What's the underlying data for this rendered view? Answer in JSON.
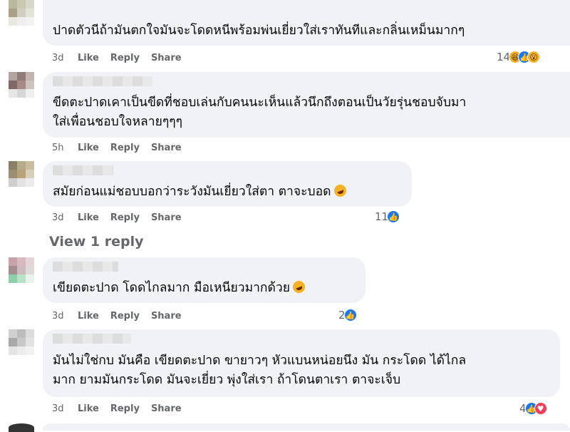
{
  "comments": [
    {
      "text": "ปาดตัวนีถ้ามันตกใจมันจะโดดหนีพร้อมพ่นเยี่ยวใส่เราทันทีและกลิ่นเหม็นมากๆ",
      "time": "3d",
      "like": "Like",
      "reply": "Reply",
      "share": "Share",
      "reaction_count": "14",
      "reactions": [
        "haha",
        "like",
        "wow"
      ]
    },
    {
      "text": "ขีดตะปาดเคาเป็นขีดที่ชอบเล่นกับคนนะเห็นแล้วนึกถึงตอนเป็นวัยรุ่นชอบจับมา\nใส่เพื่อนชอบใจหลายๆๆๆ",
      "time": "5h",
      "like": "Like",
      "reply": "Reply",
      "share": "Share",
      "reaction_count": "",
      "reactions": []
    },
    {
      "text": "สมัยก่อนแม่ชอบบอกว่าระวังมันเยี่ยวใส่ตา ตาจะบอด",
      "time": "3d",
      "like": "Like",
      "reply": "Reply",
      "share": "Share",
      "reaction_count": "11",
      "reactions": [
        "like"
      ]
    },
    {
      "text": "เขียดตะปาด โดดไกลมาก มือเหนียวมากด้วย",
      "time": "3d",
      "like": "Like",
      "reply": "Reply",
      "share": "Share",
      "reaction_count": "2",
      "reactions": [
        "like"
      ]
    },
    {
      "text": "มันไม่ใช่กบ มันคือ เขียดตะปาด ขายาวๆ หัวแบนหน่อยนึง มัน กระโดด ได้ไกล\nมาก ยามมันกระโดด มันจะเยี่ยว พุ่งใส่เรา ถ้าโดนตาเรา ตาจะเจ็บ",
      "time": "3d",
      "like": "Like",
      "reply": "Reply",
      "share": "Share",
      "reaction_count": "4",
      "reactions": [
        "like",
        "love"
      ]
    }
  ],
  "view_replies": "View 1 reply",
  "colors": {
    "bubble": "#f0f2f5",
    "meta": "#65676b",
    "like_blue": "#1877f2",
    "haha_yellow": "#f7b125",
    "love_red": "#f33e58"
  }
}
